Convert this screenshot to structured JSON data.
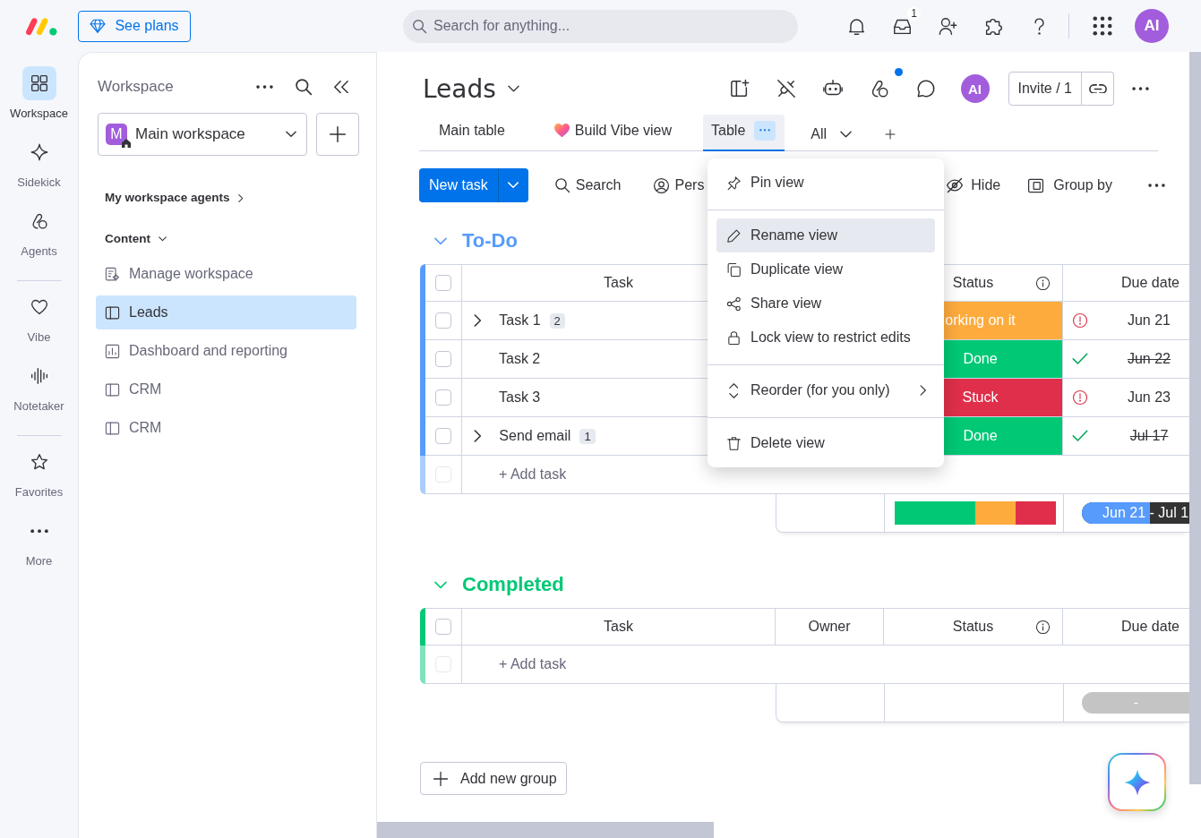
{
  "top_bar": {
    "plans_button": "See plans",
    "search": {
      "placeholder": "Search for anything..."
    },
    "inbox_badge": "1",
    "avatar": "AI"
  },
  "rail": {
    "sections": [
      [
        {
          "label": "Workspace",
          "selected": true
        },
        {
          "label": "Sidekick",
          "selected": false
        },
        {
          "label": "Agents",
          "selected": false
        }
      ],
      [
        {
          "label": "Vibe",
          "selected": false
        },
        {
          "label": "Notetaker",
          "selected": false
        }
      ],
      [
        {
          "label": "Favorites",
          "selected": false
        },
        {
          "label": "More",
          "selected": false
        }
      ]
    ]
  },
  "sidebar": {
    "title": "Workspace",
    "workspace": {
      "initial": "M",
      "name": "Main workspace"
    },
    "agents_link": "My workspace agents",
    "section": {
      "title": "Content",
      "expanded": true
    },
    "items": [
      {
        "kind": "manage",
        "label": "Manage workspace",
        "selected": false
      },
      {
        "kind": "board",
        "label": "Leads",
        "selected": true
      },
      {
        "kind": "dashboard",
        "label": "Dashboard and reporting",
        "selected": false
      },
      {
        "kind": "board",
        "label": "CRM",
        "selected": false
      },
      {
        "kind": "board",
        "label": "CRM",
        "selected": false
      }
    ]
  },
  "board": {
    "title": "Leads",
    "icons": [
      {
        "notify": false
      },
      {
        "notify": false
      },
      {
        "notify": false
      },
      {
        "notify": true
      },
      {
        "notify": false
      }
    ],
    "avatar": "AI",
    "invite": "Invite / 1",
    "views": [
      {
        "kind": "table",
        "label": "Main table",
        "selected": false
      },
      {
        "kind": "vibe",
        "label": "Build Vibe view",
        "selected": false
      },
      {
        "kind": "table",
        "label": "Table",
        "selected": true
      }
    ],
    "filter": "All",
    "toolbar": {
      "new_task": "New task",
      "search": "Search",
      "person": "Pers",
      "hide": "Hide",
      "group_by": "Group by"
    },
    "view_menu": {
      "sections": [
        [
          {
            "label": "Pin view",
            "highlighted": false,
            "submenu": false
          }
        ],
        [
          {
            "label": "Rename view",
            "highlighted": true,
            "submenu": false
          },
          {
            "label": "Duplicate view",
            "highlighted": false,
            "submenu": false
          },
          {
            "label": "Share view",
            "highlighted": false,
            "submenu": false
          },
          {
            "label": "Lock view to restrict edits",
            "highlighted": false,
            "submenu": false
          }
        ],
        [
          {
            "label": "Reorder (for you only)",
            "highlighted": false,
            "submenu": true
          }
        ],
        [
          {
            "label": "Delete view",
            "highlighted": false,
            "submenu": false
          }
        ]
      ]
    },
    "groups": [
      {
        "title": "To-Do",
        "color": "#579bfc",
        "expanded": true,
        "all_checked": false,
        "columns": {
          "task": "Task",
          "status": "Status",
          "due_date": "Due date"
        },
        "rows": [
          {
            "name": "Task 1",
            "subitems": "2",
            "expanded": false,
            "checked": false,
            "status": {
              "label": "orking on it",
              "color": "#fdab3d"
            },
            "due": {
              "date": "Jun 21",
              "done": false
            }
          },
          {
            "name": "Task 2",
            "checked": false,
            "status": {
              "label": "Done",
              "color": "#00c875"
            },
            "due": {
              "date": "Jun 22",
              "done": true
            }
          },
          {
            "name": "Task 3",
            "checked": false,
            "status": {
              "label": "Stuck",
              "color": "#df2f4a"
            },
            "due": {
              "date": "Jun 23",
              "done": false
            }
          },
          {
            "name": "Send email",
            "subitems": "1",
            "expanded": false,
            "checked": false,
            "status": {
              "label": "Done",
              "color": "#00c875"
            },
            "due": {
              "date": "Jul 17",
              "done": true
            }
          }
        ],
        "add_task": {
          "placeholder": "+ Add task",
          "checkbox_disabled": true
        },
        "summary": {
          "timeline": {
            "label": "Jun 21 - Jul 1",
            "level": 0.63
          }
        }
      },
      {
        "title": "Completed",
        "color": "#00c875",
        "expanded": true,
        "all_checked": false,
        "columns": {
          "task": "Task",
          "owner": "Owner",
          "status": "Status",
          "due_date": "Due date"
        },
        "add_task": {
          "placeholder": "+ Add task",
          "checkbox_disabled": true
        },
        "summary": {
          "timeline": {
            "label": "-"
          }
        }
      }
    ],
    "add_group": "Add new group"
  }
}
